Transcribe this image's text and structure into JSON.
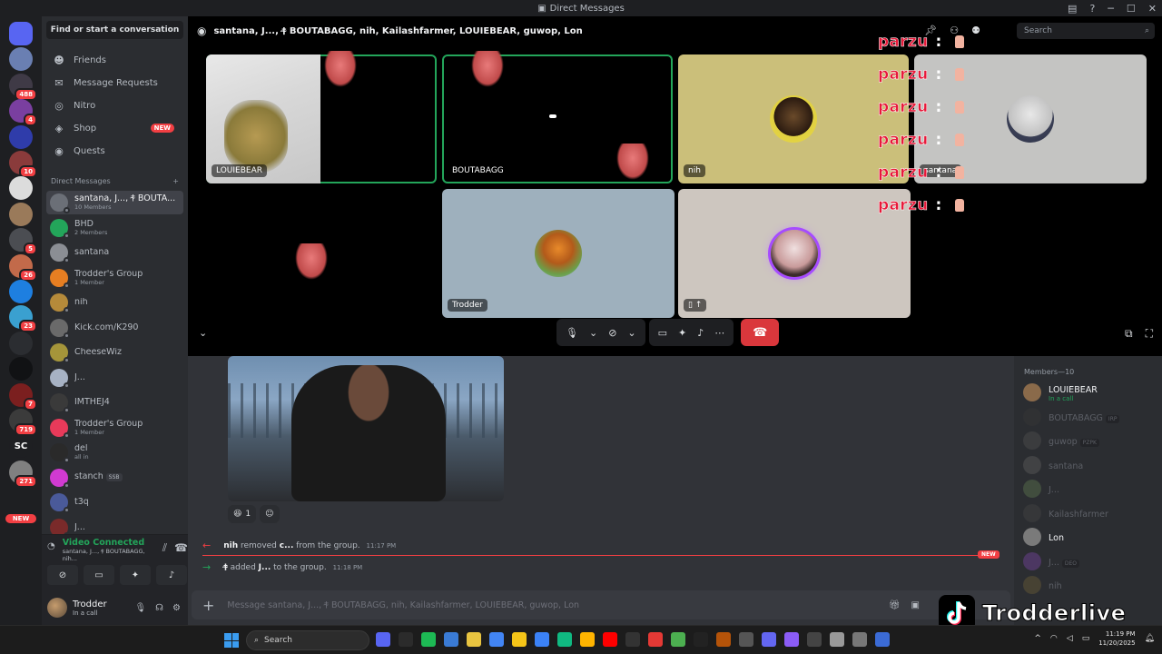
{
  "window": {
    "title": "Direct Messages"
  },
  "rail": {
    "servers": [
      {
        "name": "discord-home",
        "color": "#5865f2",
        "badge": ""
      },
      {
        "name": "server-1",
        "color": "#6a7fb2",
        "badge": ""
      },
      {
        "name": "server-2",
        "color": "#3f3a46",
        "badge": "488"
      },
      {
        "name": "server-3",
        "color": "#7a3fa0",
        "badge": "4"
      },
      {
        "name": "server-4",
        "color": "#2f3caa",
        "badge": ""
      },
      {
        "name": "server-5",
        "color": "#8a3b3b",
        "badge": "10"
      },
      {
        "name": "server-6",
        "color": "#dcdcdc",
        "badge": ""
      },
      {
        "name": "server-7",
        "color": "#9a7a5a",
        "badge": ""
      },
      {
        "name": "server-8",
        "color": "#4b4d52",
        "badge": "5"
      },
      {
        "name": "server-9",
        "color": "#c26a4a",
        "badge": "26"
      },
      {
        "name": "server-10",
        "color": "#1e7fe0",
        "badge": ""
      },
      {
        "name": "server-11",
        "color": "#3aa0d0",
        "badge": "23"
      },
      {
        "name": "server-12",
        "color": "#2b2d31",
        "badge": ""
      },
      {
        "name": "server-13",
        "color": "#111214",
        "badge": ""
      },
      {
        "name": "server-14",
        "color": "#7b1f1f",
        "badge": "7"
      },
      {
        "name": "server-15",
        "color": "#3b3b3b",
        "badge": "719"
      },
      {
        "name": "server-16",
        "color": "#1e1f22",
        "badge": ""
      },
      {
        "name": "server-17",
        "color": "#808080",
        "badge": "271"
      }
    ],
    "sc_label": "SC",
    "new_label": "NEW"
  },
  "sidebar": {
    "find_placeholder": "Find or start a conversation",
    "nav": [
      {
        "label": "Friends",
        "icon": "friends-icon"
      },
      {
        "label": "Message Requests",
        "icon": "mail-icon"
      },
      {
        "label": "Nitro",
        "icon": "nitro-icon"
      },
      {
        "label": "Shop",
        "icon": "shop-icon",
        "badge": "NEW"
      },
      {
        "label": "Quests",
        "icon": "quests-icon"
      }
    ],
    "dm_header": "Direct Messages",
    "dms": [
      {
        "name": "santana, J..., †̴ BOUTA...",
        "sub": "10 Members",
        "color": "#6b6f77",
        "active": true
      },
      {
        "name": "BHD",
        "sub": "2 Members",
        "color": "#23a55a"
      },
      {
        "name": "santana",
        "sub": "",
        "color": "#8b8e94"
      },
      {
        "name": "Trodder's Group",
        "sub": "1 Member",
        "color": "#e67e22"
      },
      {
        "name": "nih",
        "sub": "",
        "color": "#b58a3a"
      },
      {
        "name": "Kick.com/K290",
        "sub": "",
        "color": "#6a6a6a"
      },
      {
        "name": "CheeseWiz",
        "sub": "",
        "color": "#a5953a"
      },
      {
        "name": "J...",
        "sub": "",
        "color": "#a7b2c4"
      },
      {
        "name": "IMTHEJ4",
        "sub": "",
        "color": "#3a3a3a"
      },
      {
        "name": "Trodder's Group",
        "sub": "1 Member",
        "color": "#e83a5a"
      },
      {
        "name": "del",
        "sub": "all in",
        "color": "#2a2a2a"
      },
      {
        "name": "stanch",
        "sub": "",
        "color": "#d13ad1",
        "tag": "SSB"
      },
      {
        "name": "t3q",
        "sub": "",
        "color": "#4a5a9a"
      },
      {
        "name": "J...",
        "sub": "",
        "color": "#7a2a2a"
      }
    ]
  },
  "voice": {
    "status": "Video Connected",
    "channel": "santana, J..., †̴ BOUTABAGG, nih..."
  },
  "user": {
    "name": "Trodder",
    "status": "In a call"
  },
  "call": {
    "group_name": "santana, J..., †̴ BOUTABAGG, nih, Kailashfarmer, LOUIEBEAR, guwop, Lon",
    "search_placeholder": "Search",
    "tiles": [
      {
        "label": "LOUIEBEAR"
      },
      {
        "label": "BOUTABAGG"
      },
      {
        "label": "nih"
      },
      {
        "label": "santana"
      },
      {
        "label": "Trodder"
      },
      {
        "label": ""
      }
    ],
    "overlay_text": "parzu",
    "overlay_colon": ":",
    "overlay_rows": 6
  },
  "chat": {
    "reaction_count": "1",
    "system_messages": [
      {
        "actor": "nih",
        "verb": "removed",
        "target": "c...",
        "rest": "from the group.",
        "time": "11:17 PM"
      },
      {
        "actor": "†̴",
        "verb": "added",
        "target": "J...",
        "rest": "to the group.",
        "time": "11:18 PM"
      }
    ],
    "new_tag": "NEW",
    "composer_placeholder": "Message santana, J..., †̴ BOUTABAGG, nih, Kailashfarmer, LOUIEBEAR, guwop, Lon"
  },
  "members": {
    "header": "Members—10",
    "list": [
      {
        "name": "LOUIEBEAR",
        "sub": "In a call",
        "dim": false,
        "tag": ""
      },
      {
        "name": "BOUTABAGG",
        "sub": "",
        "dim": true,
        "tag": "IRP"
      },
      {
        "name": "guwop",
        "sub": "",
        "dim": true,
        "tag": "PZPK"
      },
      {
        "name": "santana",
        "sub": "",
        "dim": true,
        "tag": ""
      },
      {
        "name": "J...",
        "sub": "",
        "dim": true,
        "tag": ""
      },
      {
        "name": "Kailashfarmer",
        "sub": "",
        "dim": true,
        "tag": ""
      },
      {
        "name": "Lon",
        "sub": "",
        "dim": false,
        "tag": ""
      },
      {
        "name": "J...",
        "sub": "",
        "dim": true,
        "tag": "DEO"
      },
      {
        "name": "nih",
        "sub": "",
        "dim": true,
        "tag": ""
      }
    ]
  },
  "watermark": {
    "text": "Trodderlive"
  },
  "taskbar": {
    "search_label": "Search",
    "time": "11:19 PM",
    "date": "11/20/2025"
  }
}
